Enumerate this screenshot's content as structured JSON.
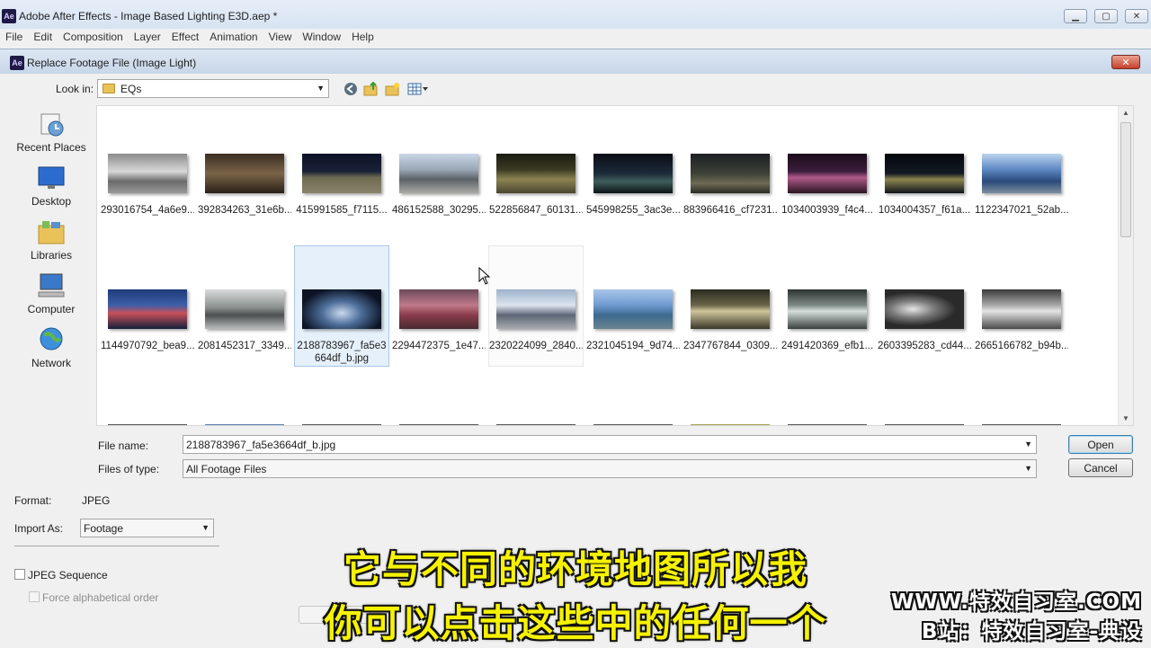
{
  "app": {
    "title": "Adobe After Effects - Image Based Lighting E3D.aep *",
    "logo_text": "Ae",
    "menu": [
      "File",
      "Edit",
      "Composition",
      "Layer",
      "Effect",
      "Animation",
      "View",
      "Window",
      "Help"
    ]
  },
  "dialog": {
    "title": "Replace Footage File (Image Light)",
    "look_in_label": "Look in:",
    "look_in_value": "EQs",
    "places": [
      {
        "label": "Recent Places",
        "icon": "recent-places-icon"
      },
      {
        "label": "Desktop",
        "icon": "desktop-icon"
      },
      {
        "label": "Libraries",
        "icon": "libraries-icon"
      },
      {
        "label": "Computer",
        "icon": "computer-icon"
      },
      {
        "label": "Network",
        "icon": "network-icon"
      }
    ],
    "files_row1": [
      "293016754_4a6e9...",
      "392834263_31e6b...",
      "415991585_f7115...",
      "486152588_30295...",
      "522856847_60131...",
      "545998255_3ac3e...",
      "883966416_cf7231...",
      "1034003939_f4c4...",
      "1034004357_f61a...",
      "1122347021_52ab..."
    ],
    "files_row2": [
      "1144970792_bea9...",
      "2081452317_3349...",
      "2188783967_fa5e3664df_b.jpg",
      "2294472375_1e47...",
      "2320224099_2840...",
      "2321045194_9d74...",
      "2347767844_0309...",
      "2491420369_efb1...",
      "2603395283_cd44...",
      "2665166782_b94b..."
    ],
    "file_name_label": "File name:",
    "file_name_value": "2188783967_fa5e3664df_b.jpg",
    "file_type_label": "Files of type:",
    "file_type_value": "All Footage Files",
    "open_label": "Open",
    "cancel_label": "Cancel",
    "format_label": "Format:",
    "format_value": "JPEG",
    "import_as_label": "Import As:",
    "import_as_value": "Footage",
    "jpeg_sequence_label": "JPEG Sequence",
    "force_alpha_label": "Force alphabetical order"
  },
  "overlay": {
    "subtitle_line1": "它与不同的环境地图所以我",
    "subtitle_line2": "你可以点击这些中的任何一个",
    "watermark_line1": "WWW.特效自习室.COM",
    "watermark_line2": "B站：特效自习室-典设"
  }
}
